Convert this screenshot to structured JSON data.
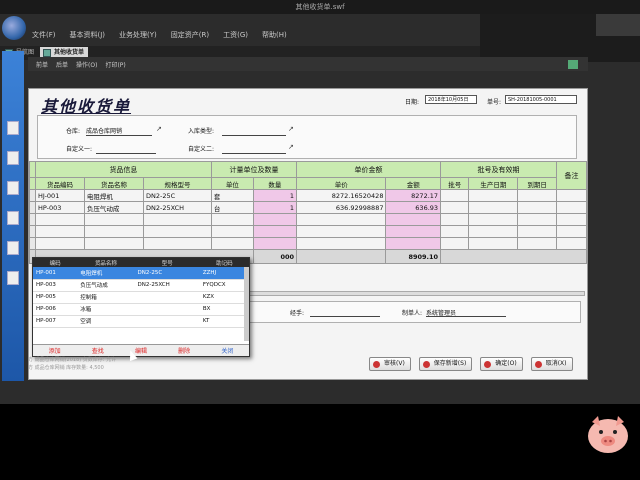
{
  "window": {
    "title": "其他收货单.swf"
  },
  "menu": [
    "文件(F)",
    "基本资料(J)",
    "业务处理(Y)",
    "固定资产(R)",
    "工资(G)",
    "帮助(H)"
  ],
  "tabs": [
    {
      "label": "导航图",
      "active": false
    },
    {
      "label": "其他收货单",
      "active": true
    }
  ],
  "toolbar": {
    "items": [
      "前单",
      "后单",
      "操作(O)",
      "打印(P)"
    ]
  },
  "form": {
    "title": "其他收货单",
    "date_label": "日期:",
    "date_value": "2018年10月05日",
    "no_label": "单号:",
    "no_value": "SH-20181005-0001",
    "warehouse_label": "仓库:",
    "warehouse_value": "成品仓库网销",
    "in_type_label": "入库类型:",
    "custom1_label": "自定义一:",
    "custom2_label": "自定义二:"
  },
  "grid": {
    "group_headers": [
      "货品信息",
      "计量单位及数量",
      "单价金额",
      "批号及有效期",
      "备注"
    ],
    "columns": [
      "货品编码",
      "货品名称",
      "规格型号",
      "单位",
      "数量",
      "单价",
      "金额",
      "批号",
      "生产日期",
      "到期日"
    ],
    "rows": [
      {
        "code": "HJ-001",
        "name": "电阻焊机",
        "spec": "DN2-25C",
        "unit": "套",
        "qty": "1",
        "price": "8272.16520428",
        "amount": "8272.17"
      },
      {
        "code": "HP-003",
        "name": "负压气动成",
        "spec": "DN2-25XCH",
        "unit": "台",
        "qty": "1",
        "price": "636.92998887",
        "amount": "636.93"
      }
    ],
    "total_qty": "000",
    "total_amount": "8909.10"
  },
  "footer": {
    "handler_label": "经手:",
    "maker_label": "制单人:",
    "maker_value": "系统管理员"
  },
  "popup": {
    "headers": [
      "编码",
      "货品名称",
      "型号",
      "助记码"
    ],
    "rows": [
      {
        "code": "HP-001",
        "name": "电阻焊机",
        "model": "DN2-25C",
        "mnem": "ZZHJ"
      },
      {
        "code": "HP-003",
        "name": "负压气动成",
        "model": "DN2-25XCH",
        "mnem": "FYQDCX"
      },
      {
        "code": "HP-005",
        "name": "控制箱",
        "model": "",
        "mnem": "KZX"
      },
      {
        "code": "HP-006",
        "name": "冰箱",
        "model": "",
        "mnem": "BX"
      },
      {
        "code": "HP-007",
        "name": "空调",
        "model": "",
        "mnem": "KT"
      }
    ],
    "actions": [
      "添加",
      "查找",
      "编辑",
      "删除",
      "关闭"
    ]
  },
  "buttons": [
    "审核(V)",
    "保存新增(S)",
    "确定(O)",
    "取消(X)"
  ],
  "status": {
    "line1": "方 成品仓库网销(2018) 负数库存: 允许",
    "line2": "方 成品仓库网销 库存数量: 4,500"
  },
  "colors": {
    "sidebar": "#2f6fc4",
    "grid_header": "#c9eab0",
    "pink_cell": "#f0c8e8",
    "popup_selected": "#3a86e0"
  }
}
